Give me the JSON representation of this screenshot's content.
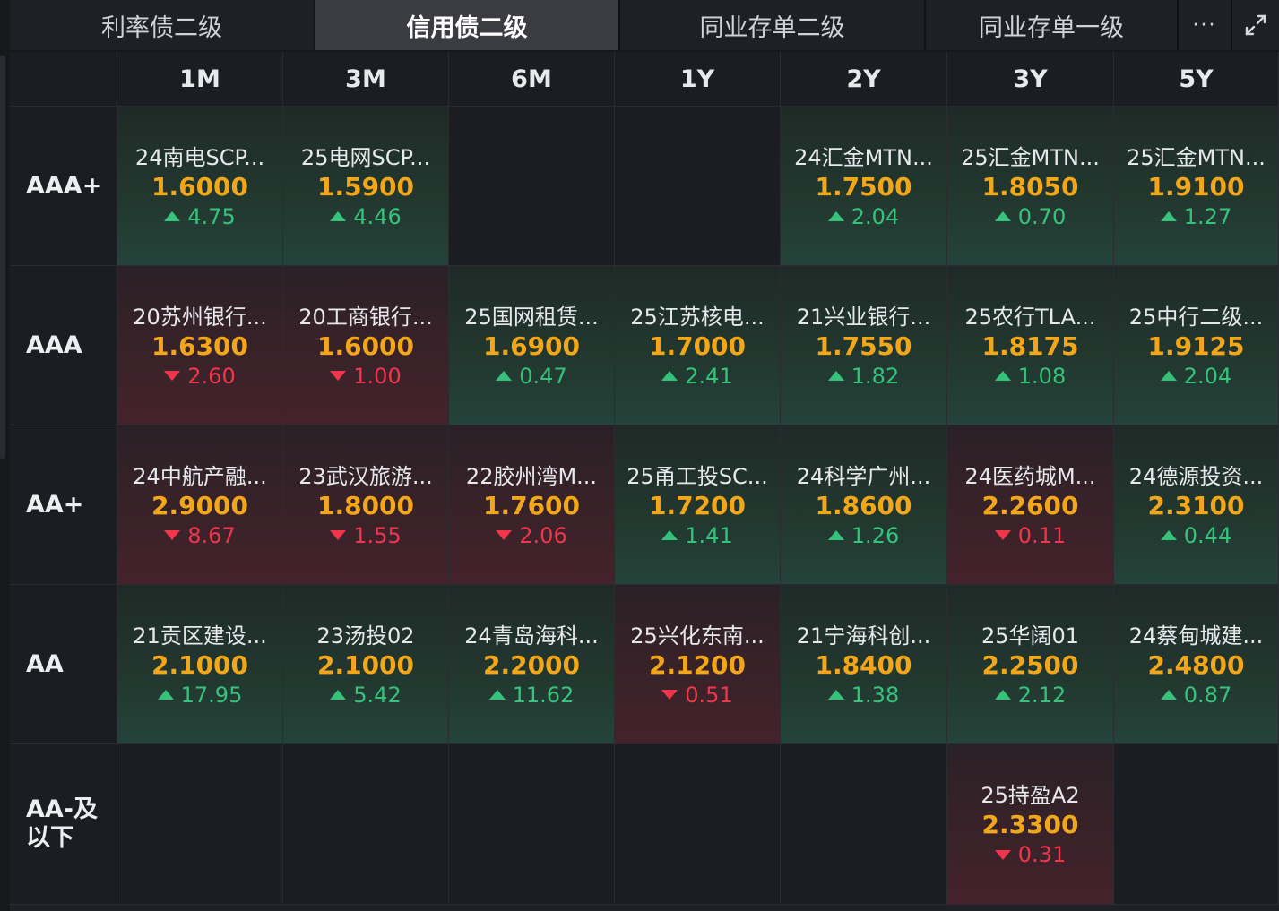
{
  "tabs": [
    {
      "label": "利率债二级",
      "active": false
    },
    {
      "label": "信用债二级",
      "active": true
    },
    {
      "label": "同业存单二级",
      "active": false
    },
    {
      "label": "同业存单一级",
      "active": false
    }
  ],
  "more_label": "···",
  "columns": [
    "1M",
    "3M",
    "6M",
    "1Y",
    "2Y",
    "3Y",
    "5Y"
  ],
  "rows": [
    {
      "rating": "AAA+",
      "cells": [
        {
          "name": "24南电SCP...",
          "yield": "1.6000",
          "dir": "up",
          "change": "4.75"
        },
        {
          "name": "25电网SCP...",
          "yield": "1.5900",
          "dir": "up",
          "change": "4.46"
        },
        null,
        null,
        {
          "name": "24汇金MTN...",
          "yield": "1.7500",
          "dir": "up",
          "change": "2.04"
        },
        {
          "name": "25汇金MTN...",
          "yield": "1.8050",
          "dir": "up",
          "change": "0.70"
        },
        {
          "name": "25汇金MTN...",
          "yield": "1.9100",
          "dir": "up",
          "change": "1.27"
        }
      ]
    },
    {
      "rating": "AAA",
      "cells": [
        {
          "name": "20苏州银行...",
          "yield": "1.6300",
          "dir": "down",
          "change": "2.60"
        },
        {
          "name": "20工商银行...",
          "yield": "1.6000",
          "dir": "down",
          "change": "1.00"
        },
        {
          "name": "25国网租赁...",
          "yield": "1.6900",
          "dir": "up",
          "change": "0.47"
        },
        {
          "name": "25江苏核电...",
          "yield": "1.7000",
          "dir": "up",
          "change": "2.41"
        },
        {
          "name": "21兴业银行...",
          "yield": "1.7550",
          "dir": "up",
          "change": "1.82"
        },
        {
          "name": "25农行TLA...",
          "yield": "1.8175",
          "dir": "up",
          "change": "1.08"
        },
        {
          "name": "25中行二级...",
          "yield": "1.9125",
          "dir": "up",
          "change": "2.04"
        }
      ]
    },
    {
      "rating": "AA+",
      "cells": [
        {
          "name": "24中航产融...",
          "yield": "2.9000",
          "dir": "down",
          "change": "8.67"
        },
        {
          "name": "23武汉旅游...",
          "yield": "1.8000",
          "dir": "down",
          "change": "1.55"
        },
        {
          "name": "22胶州湾M...",
          "yield": "1.7600",
          "dir": "down",
          "change": "2.06"
        },
        {
          "name": "25甬工投SC...",
          "yield": "1.7200",
          "dir": "up",
          "change": "1.41"
        },
        {
          "name": "24科学广州...",
          "yield": "1.8600",
          "dir": "up",
          "change": "1.26"
        },
        {
          "name": "24医药城M...",
          "yield": "2.2600",
          "dir": "down",
          "change": "0.11"
        },
        {
          "name": "24德源投资...",
          "yield": "2.3100",
          "dir": "up",
          "change": "0.44"
        }
      ]
    },
    {
      "rating": "AA",
      "cells": [
        {
          "name": "21贡区建设...",
          "yield": "2.1000",
          "dir": "up",
          "change": "17.95"
        },
        {
          "name": "23汤投02",
          "yield": "2.1000",
          "dir": "up",
          "change": "5.42"
        },
        {
          "name": "24青岛海科...",
          "yield": "2.2000",
          "dir": "up",
          "change": "11.62"
        },
        {
          "name": "25兴化东南...",
          "yield": "2.1200",
          "dir": "down",
          "change": "0.51"
        },
        {
          "name": "21宁海科创...",
          "yield": "1.8400",
          "dir": "up",
          "change": "1.38"
        },
        {
          "name": "25华阔01",
          "yield": "2.2500",
          "dir": "up",
          "change": "2.12"
        },
        {
          "name": "24蔡甸城建...",
          "yield": "2.4800",
          "dir": "up",
          "change": "0.87"
        }
      ]
    },
    {
      "rating": "AA-及以下",
      "rating_lines": [
        "AA-及",
        "以下"
      ],
      "cells": [
        null,
        null,
        null,
        null,
        null,
        {
          "name": "25持盈A2",
          "yield": "2.3300",
          "dir": "down",
          "change": "0.31"
        },
        null
      ]
    }
  ],
  "colors": {
    "up": "#36c27a",
    "down": "#f0364a",
    "yield": "#f2a71b",
    "active_tab": "#3a3c42"
  },
  "icons": {
    "more": "ellipsis-icon",
    "expand": "expand-icon"
  }
}
